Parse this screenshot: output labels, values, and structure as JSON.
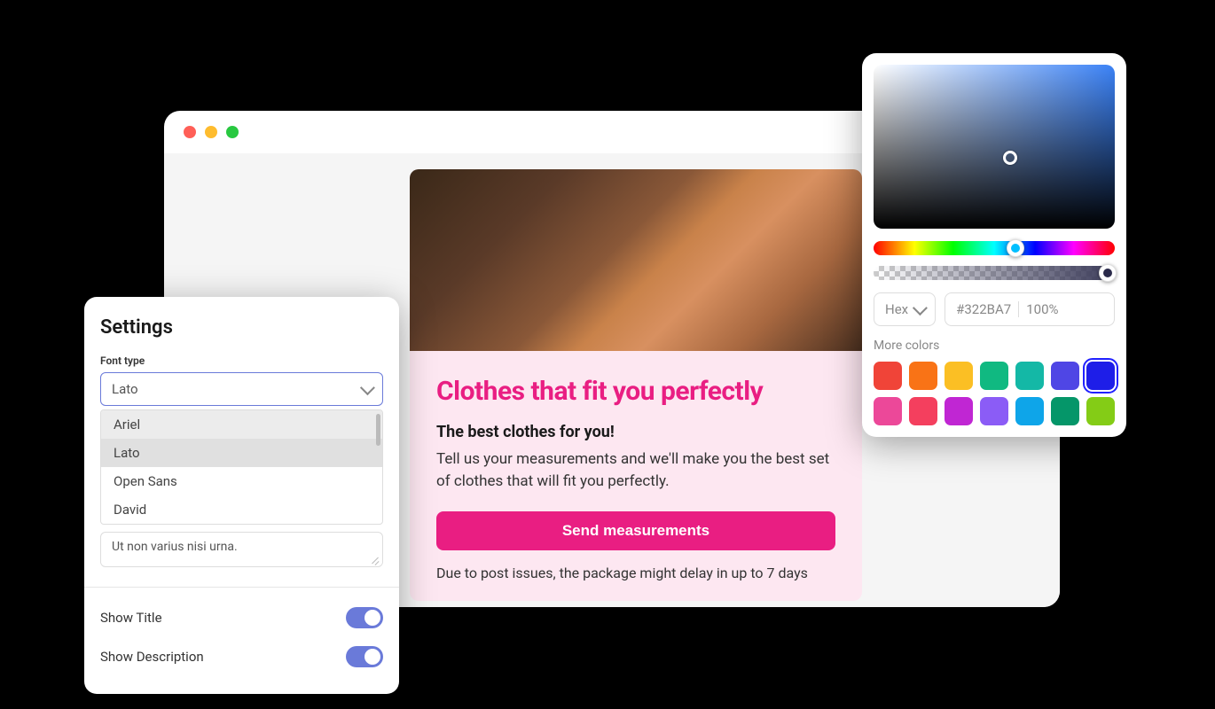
{
  "browser": {},
  "card": {
    "title": "Clothes that fit you perfectly",
    "subtitle": "The best clothes for you!",
    "text": "Tell us your measurements and we'll make you the best set of clothes that will fit you perfectly.",
    "button": "Send measurements",
    "note": "Due to post issues, the package might delay in up to 7 days"
  },
  "settings": {
    "title": "Settings",
    "font_type_label": "Font type",
    "font_selected": "Lato",
    "font_options": [
      "Ariel",
      "Lato",
      "Open Sans",
      "David"
    ],
    "textarea_value": "Ut non varius nisi urna.",
    "show_title_label": "Show Title",
    "show_title_value": true,
    "show_description_label": "Show Description",
    "show_description_value": true
  },
  "color_picker": {
    "format": "Hex",
    "hex_value": "#322BA7",
    "opacity": "100%",
    "more_colors_label": "More colors",
    "swatches_row1": [
      "#f04438",
      "#f97316",
      "#fbbf24",
      "#10b981",
      "#14b8a6",
      "#4f46e5",
      "#1e1ee8"
    ],
    "swatches_row2": [
      "#ec4899",
      "#f43f5e",
      "#c026d3",
      "#8b5cf6",
      "#0ea5e9",
      "#059669",
      "#84cc16"
    ],
    "selected_swatch": "#1e1ee8"
  }
}
